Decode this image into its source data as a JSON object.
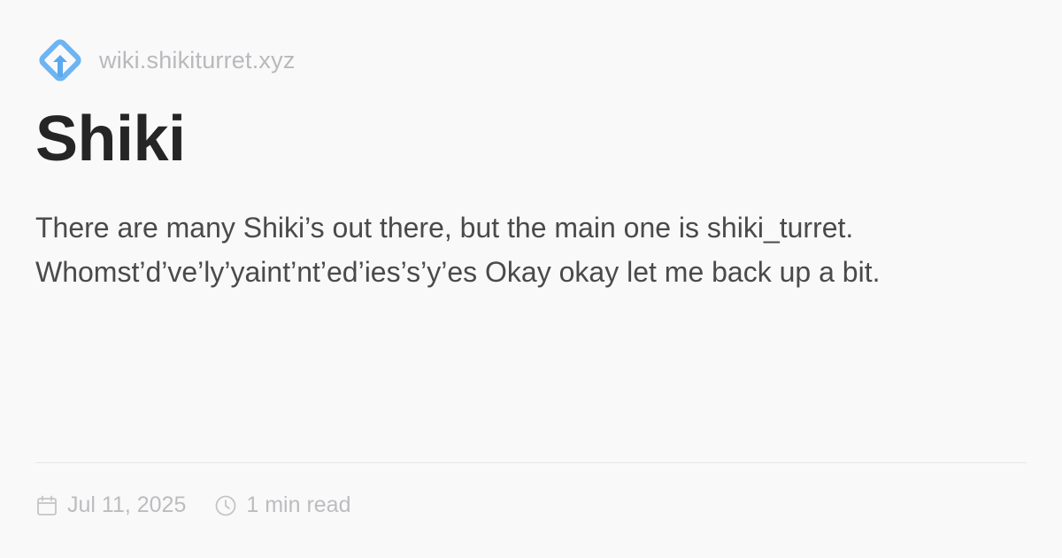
{
  "site": {
    "domain": "wiki.shikiturret.xyz",
    "logo_icon": "diamond-arrow-logo-icon",
    "brand_color": "#5aa9ee"
  },
  "article": {
    "title": "Shiki",
    "description": "There are many Shiki’s out there, but the main one is shiki_turret. Whomst’d’ve’ly’yaint’nt’ed’ies’s’y’es Okay okay let me back up a bit."
  },
  "meta": {
    "date": "Jul 11, 2025",
    "date_icon": "calendar-icon",
    "read_time": "1 min read",
    "read_time_icon": "clock-icon"
  }
}
